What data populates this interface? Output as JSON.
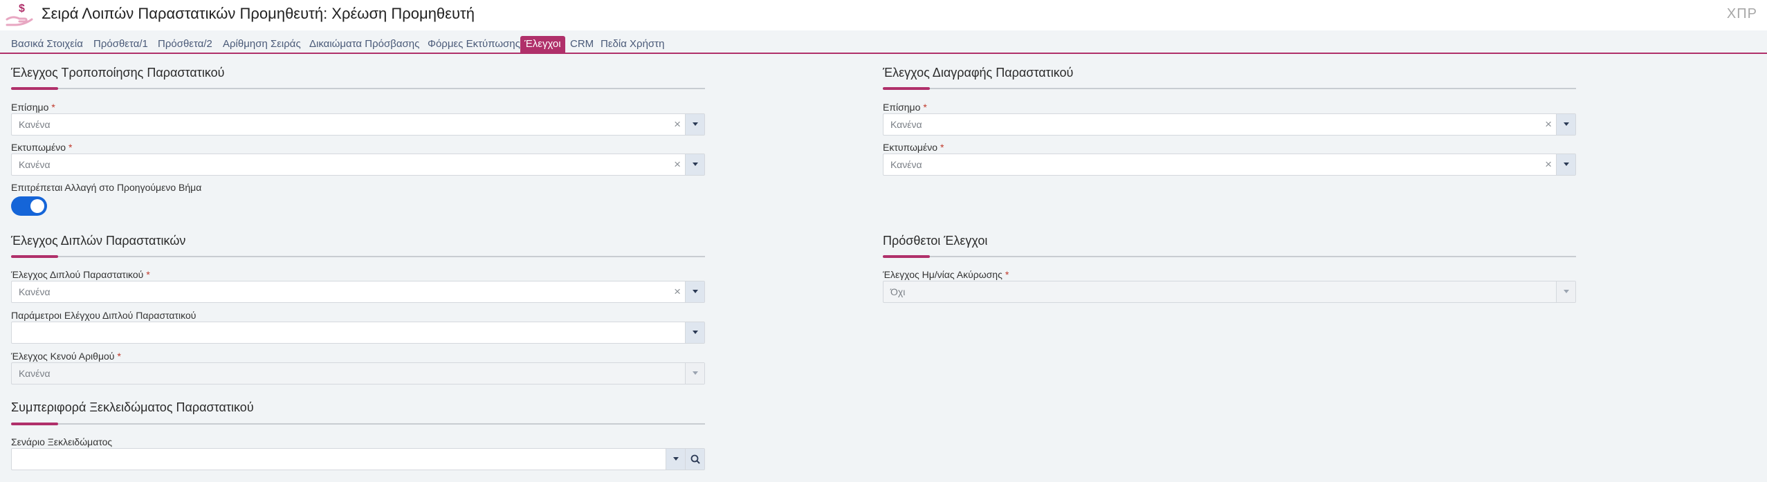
{
  "header": {
    "title": "Σειρά Λοιπών Παραστατικών Προμηθευτή: Χρέωση Προμηθευτή",
    "user_code": "ΧΠΡ",
    "icon": "money-hand-icon",
    "accent_color": "#b0306a"
  },
  "tabs": [
    {
      "label": "Βασικά Στοιχεία"
    },
    {
      "label": "Πρόσθετα/1"
    },
    {
      "label": "Πρόσθετα/2"
    },
    {
      "label": "Αρίθμηση Σειράς"
    },
    {
      "label": "Δικαιώματα Πρόσβασης"
    },
    {
      "label": "Φόρμες Εκτύπωσης"
    },
    {
      "label": "Έλεγχοι",
      "active": true
    },
    {
      "label": "CRM"
    },
    {
      "label": "Πεδία Χρήστη"
    }
  ],
  "sections": {
    "modification": {
      "title": "Έλεγχος Τροποποίησης Παραστατικού",
      "official": {
        "label": "Επίσημο",
        "required": "*",
        "value": "Κανένα"
      },
      "printed": {
        "label": "Εκτυπωμένο",
        "required": "*",
        "value": "Κανένα"
      },
      "allow_prev_step": {
        "label": "Επιτρέπεται Αλλαγή στο Προηγούμενο Βήμα",
        "checked": true
      }
    },
    "deletion": {
      "title": "Έλεγχος Διαγραφής Παραστατικού",
      "official": {
        "label": "Επίσημο",
        "required": "*",
        "value": "Κανένα"
      },
      "printed": {
        "label": "Εκτυπωμένο",
        "required": "*",
        "value": "Κανένα"
      }
    },
    "duplicates": {
      "title": "Έλεγχος Διπλών Παραστατικών",
      "duplicate_check": {
        "label": "Έλεγχος Διπλού Παραστατικού",
        "required": "*",
        "value": "Κανένα"
      },
      "duplicate_params": {
        "label": "Παράμετροι Ελέγχου Διπλού Παραστατικού",
        "value": ""
      },
      "gap_check": {
        "label": "Έλεγχος Κενού Αριθμού",
        "required": "*",
        "value": "Κανένα"
      }
    },
    "additional": {
      "title": "Πρόσθετοι Έλεγχοι",
      "cancel_date_check": {
        "label": "Έλεγχος Ημ/νίας Ακύρωσης",
        "required": "*",
        "value": "Όχι"
      }
    },
    "unlock": {
      "title": "Συμπεριφορά Ξεκλειδώματος Παραστατικού",
      "scenario": {
        "label": "Σενάριο Ξεκλειδώματος",
        "value": ""
      }
    }
  }
}
